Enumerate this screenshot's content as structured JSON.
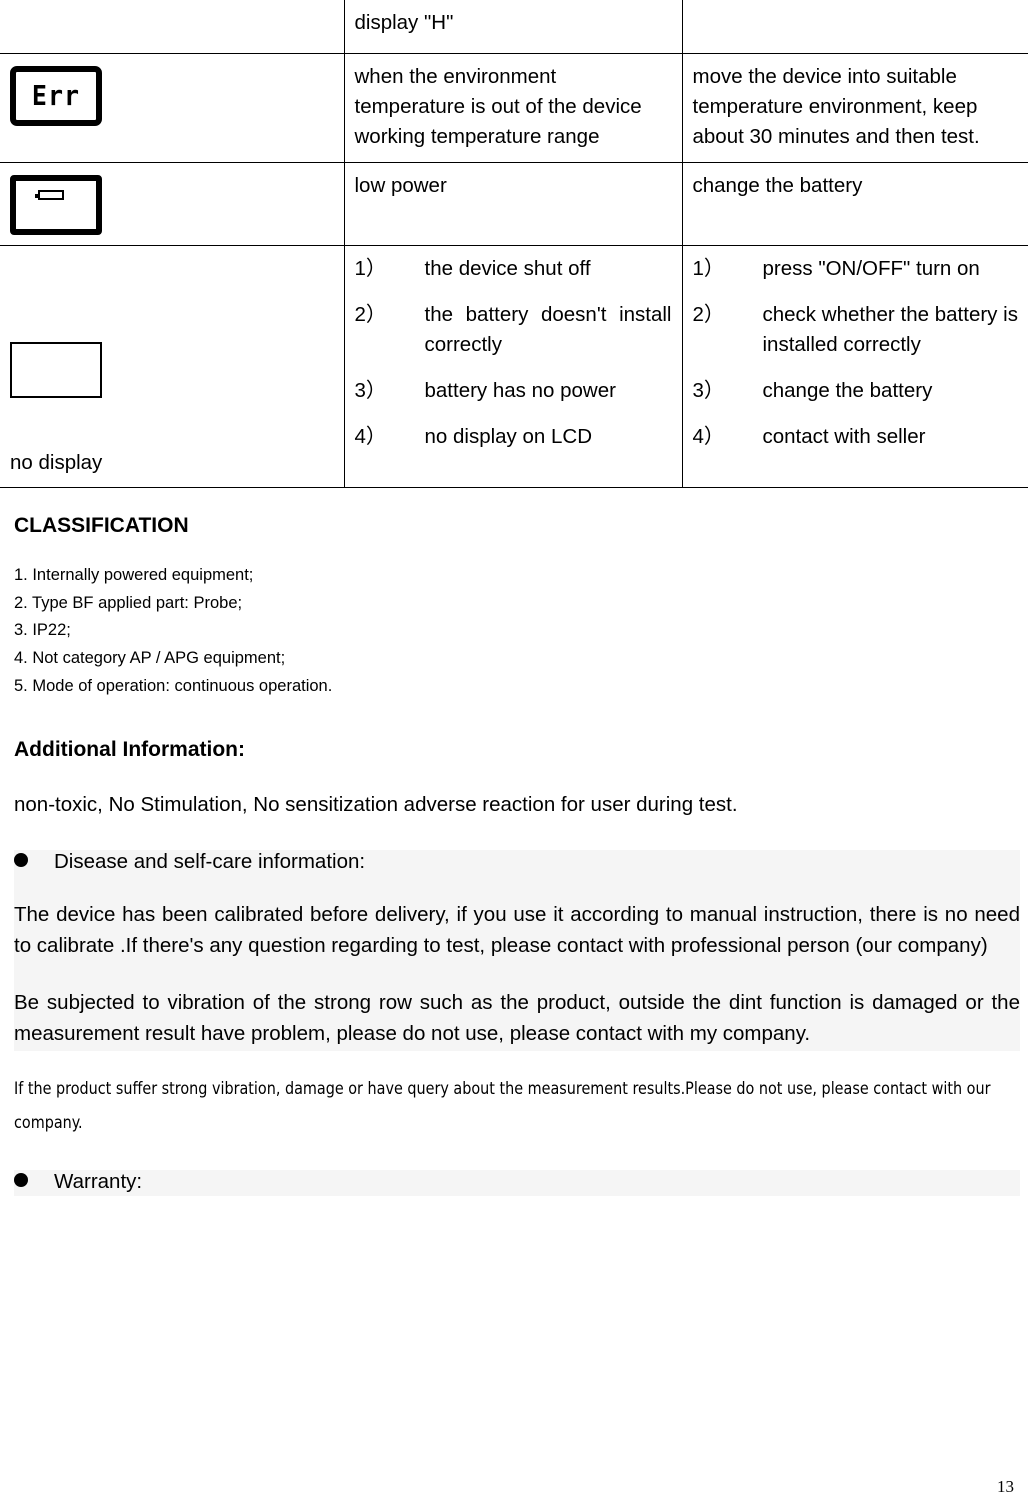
{
  "table": {
    "rows": [
      {
        "icon": "none",
        "cause": "display \"H\"",
        "fix": ""
      },
      {
        "icon": "lcd-err",
        "icon_text": "Err",
        "cause": "when the environment temperature is out of the device working temperature range",
        "fix": "move the device into suitable temperature environment, keep about 30 minutes and then test."
      },
      {
        "icon": "lcd-battery",
        "cause": "low power",
        "fix": "change the battery"
      },
      {
        "icon": "lcd-blank",
        "icon_label": "no display",
        "cause_items": [
          {
            "num": "1）",
            "text": "the device shut off"
          },
          {
            "num": "2）",
            "text": "the battery doesn't install correctly"
          },
          {
            "num": "3）",
            "text": "battery has no power"
          },
          {
            "num": "4）",
            "text": "no display on LCD"
          }
        ],
        "fix_items": [
          {
            "num": "1）",
            "text": "press \"ON/OFF\" turn on"
          },
          {
            "num": "2）",
            "text": "check whether the battery is installed correctly"
          },
          {
            "num": "3）",
            "text": "change the battery"
          },
          {
            "num": "4）",
            "text": "contact with seller"
          }
        ]
      }
    ]
  },
  "classification": {
    "heading": "CLASSIFICATION",
    "items": [
      "1. Internally powered equipment;",
      "2. Type BF applied part: Probe;",
      "3. IP22;",
      "4. Not category AP / APG equipment;",
      "5. Mode of operation: continuous operation."
    ]
  },
  "additional": {
    "heading": "Additional Information:",
    "intro": "non-toxic, No Stimulation, No sensitization adverse reaction for user during test.",
    "bullet_disease": "Disease and self-care information:",
    "paragraph_calibration": "The device has been calibrated before delivery, if you use it according to manual instruction, there is no need to calibrate .If there's any question regarding to test, please contact with professional person (our company)",
    "paragraph_vibration": "Be subjected to vibration of the strong row such as the product, outside the dint function is damaged or the measurement result have problem, please do not use, please contact with my company.",
    "paragraph_small": "If the product    suffer strong vibration, damage or have query about the measurement results.Please do not use, please contact with our company.",
    "bullet_warranty": "Warranty:"
  },
  "footer": {
    "page_number": "13"
  }
}
